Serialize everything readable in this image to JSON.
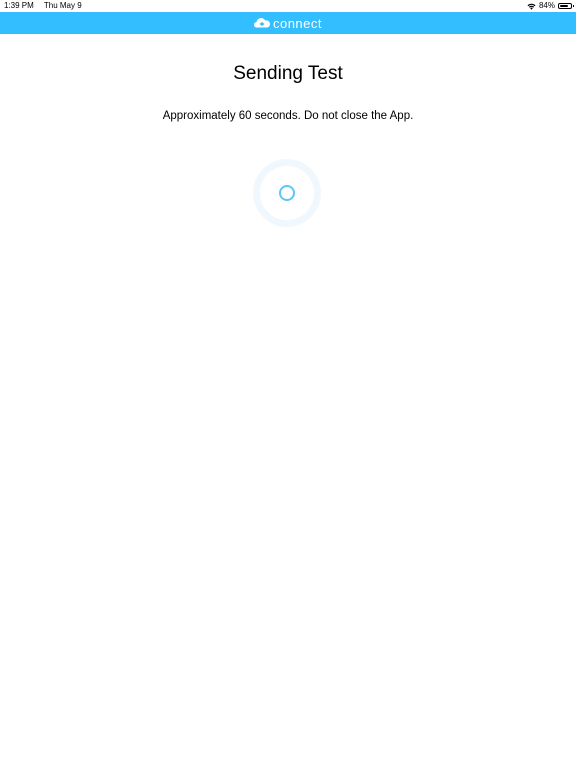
{
  "status_bar": {
    "time": "1:39 PM",
    "date": "Thu May 9",
    "battery_percent": "84%",
    "battery_level": 0.84
  },
  "nav": {
    "logo_text": "connect",
    "logo_icon": "cloud-logo-icon",
    "background_color": "#33bfff"
  },
  "main": {
    "title": "Sending Test",
    "subtitle": "Approximately 60 seconds. Do not close the App."
  },
  "spinner": {
    "icon": "loading-spinner-icon",
    "color": "#5cc7f5"
  }
}
